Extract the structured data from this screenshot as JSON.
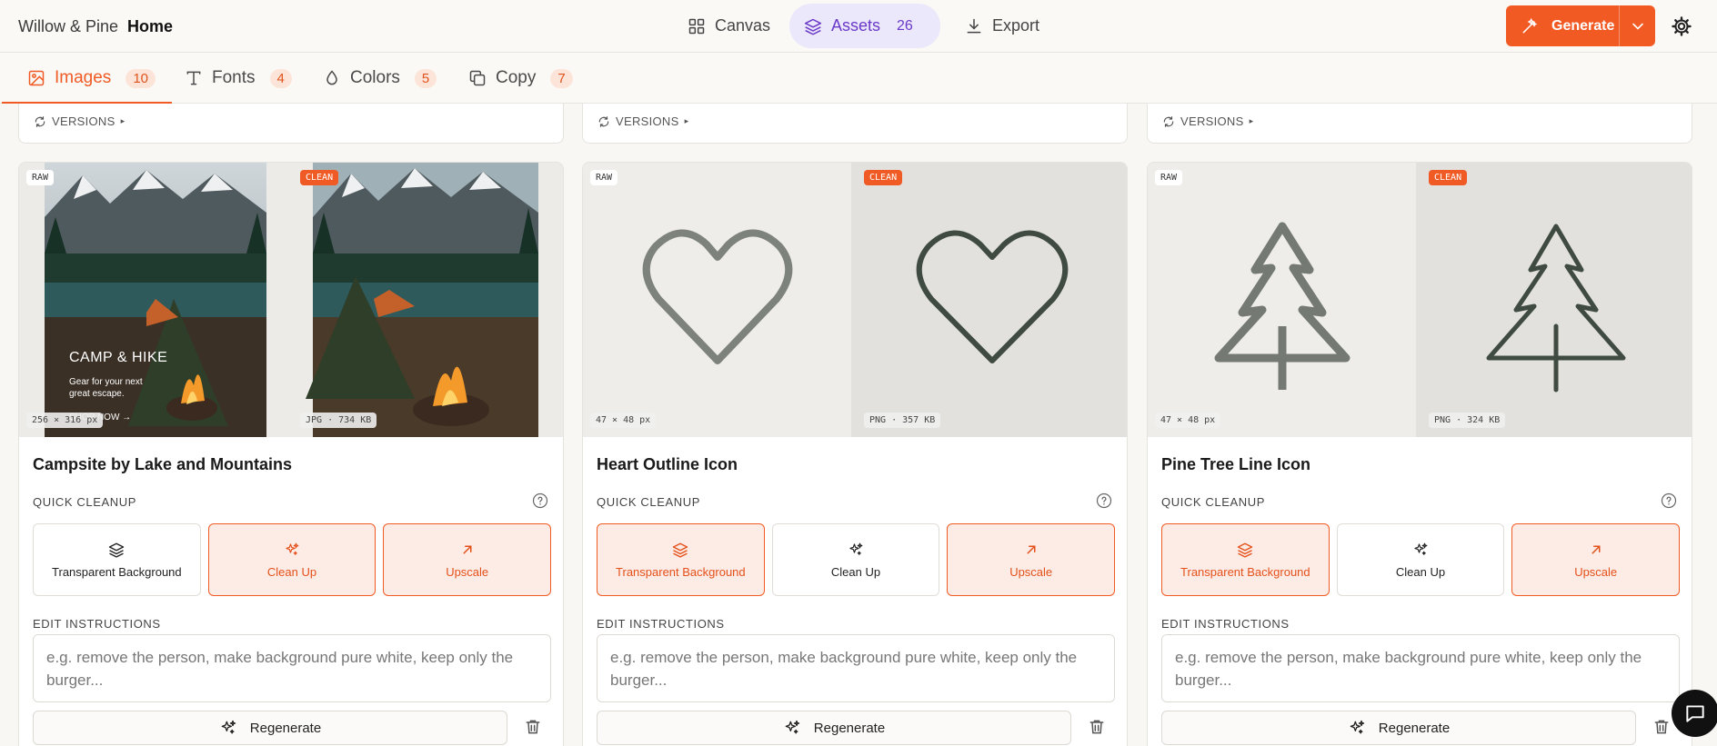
{
  "header": {
    "brand": "Willow & Pine",
    "crumb": "Home",
    "nav": [
      {
        "label": "Canvas",
        "icon": "grid-icon"
      },
      {
        "label": "Assets",
        "icon": "layers-icon",
        "count": "26",
        "active": true
      },
      {
        "label": "Export",
        "icon": "download-icon"
      }
    ],
    "generate_label": "Generate"
  },
  "tabs": [
    {
      "label": "Images",
      "count": "10",
      "active": true
    },
    {
      "label": "Fonts",
      "count": "4"
    },
    {
      "label": "Colors",
      "count": "5"
    },
    {
      "label": "Copy",
      "count": "7"
    }
  ],
  "versions_label": "VERSIONS",
  "accent_color": "#f05a24",
  "cards": [
    {
      "raw_tag": "RAW",
      "clean_tag": "CLEAN",
      "raw_meta": "256 × 316 px",
      "clean_meta": "JPG · 734 KB",
      "raw_overlay_title": "CAMP & HIKE",
      "raw_overlay_sub": "Gear for your next great escape.",
      "raw_overlay_cta": "SHOP NOW",
      "title": "Campsite by Lake and Mountains",
      "quick_label": "QUICK CLEANUP",
      "actions": [
        "Transparent Background",
        "Clean Up",
        "Upscale"
      ],
      "selected": [
        false,
        true,
        true
      ],
      "edit_label": "EDIT INSTRUCTIONS",
      "placeholder": "e.g. remove the person, make background pure white, keep only the burger...",
      "regen_label": "Regenerate"
    },
    {
      "raw_tag": "RAW",
      "clean_tag": "CLEAN",
      "raw_meta": "47 × 48 px",
      "clean_meta": "PNG · 357 KB",
      "title": "Heart Outline Icon",
      "quick_label": "QUICK CLEANUP",
      "actions": [
        "Transparent Background",
        "Clean Up",
        "Upscale"
      ],
      "selected": [
        true,
        false,
        true
      ],
      "edit_label": "EDIT INSTRUCTIONS",
      "placeholder": "e.g. remove the person, make background pure white, keep only the burger...",
      "regen_label": "Regenerate"
    },
    {
      "raw_tag": "RAW",
      "clean_tag": "CLEAN",
      "raw_meta": "47 × 48 px",
      "clean_meta": "PNG · 324 KB",
      "title": "Pine Tree Line Icon",
      "quick_label": "QUICK CLEANUP",
      "actions": [
        "Transparent Background",
        "Clean Up",
        "Upscale"
      ],
      "selected": [
        true,
        false,
        true
      ],
      "edit_label": "EDIT INSTRUCTIONS",
      "placeholder": "e.g. remove the person, make background pure white, keep only the burger...",
      "regen_label": "Regenerate"
    }
  ]
}
